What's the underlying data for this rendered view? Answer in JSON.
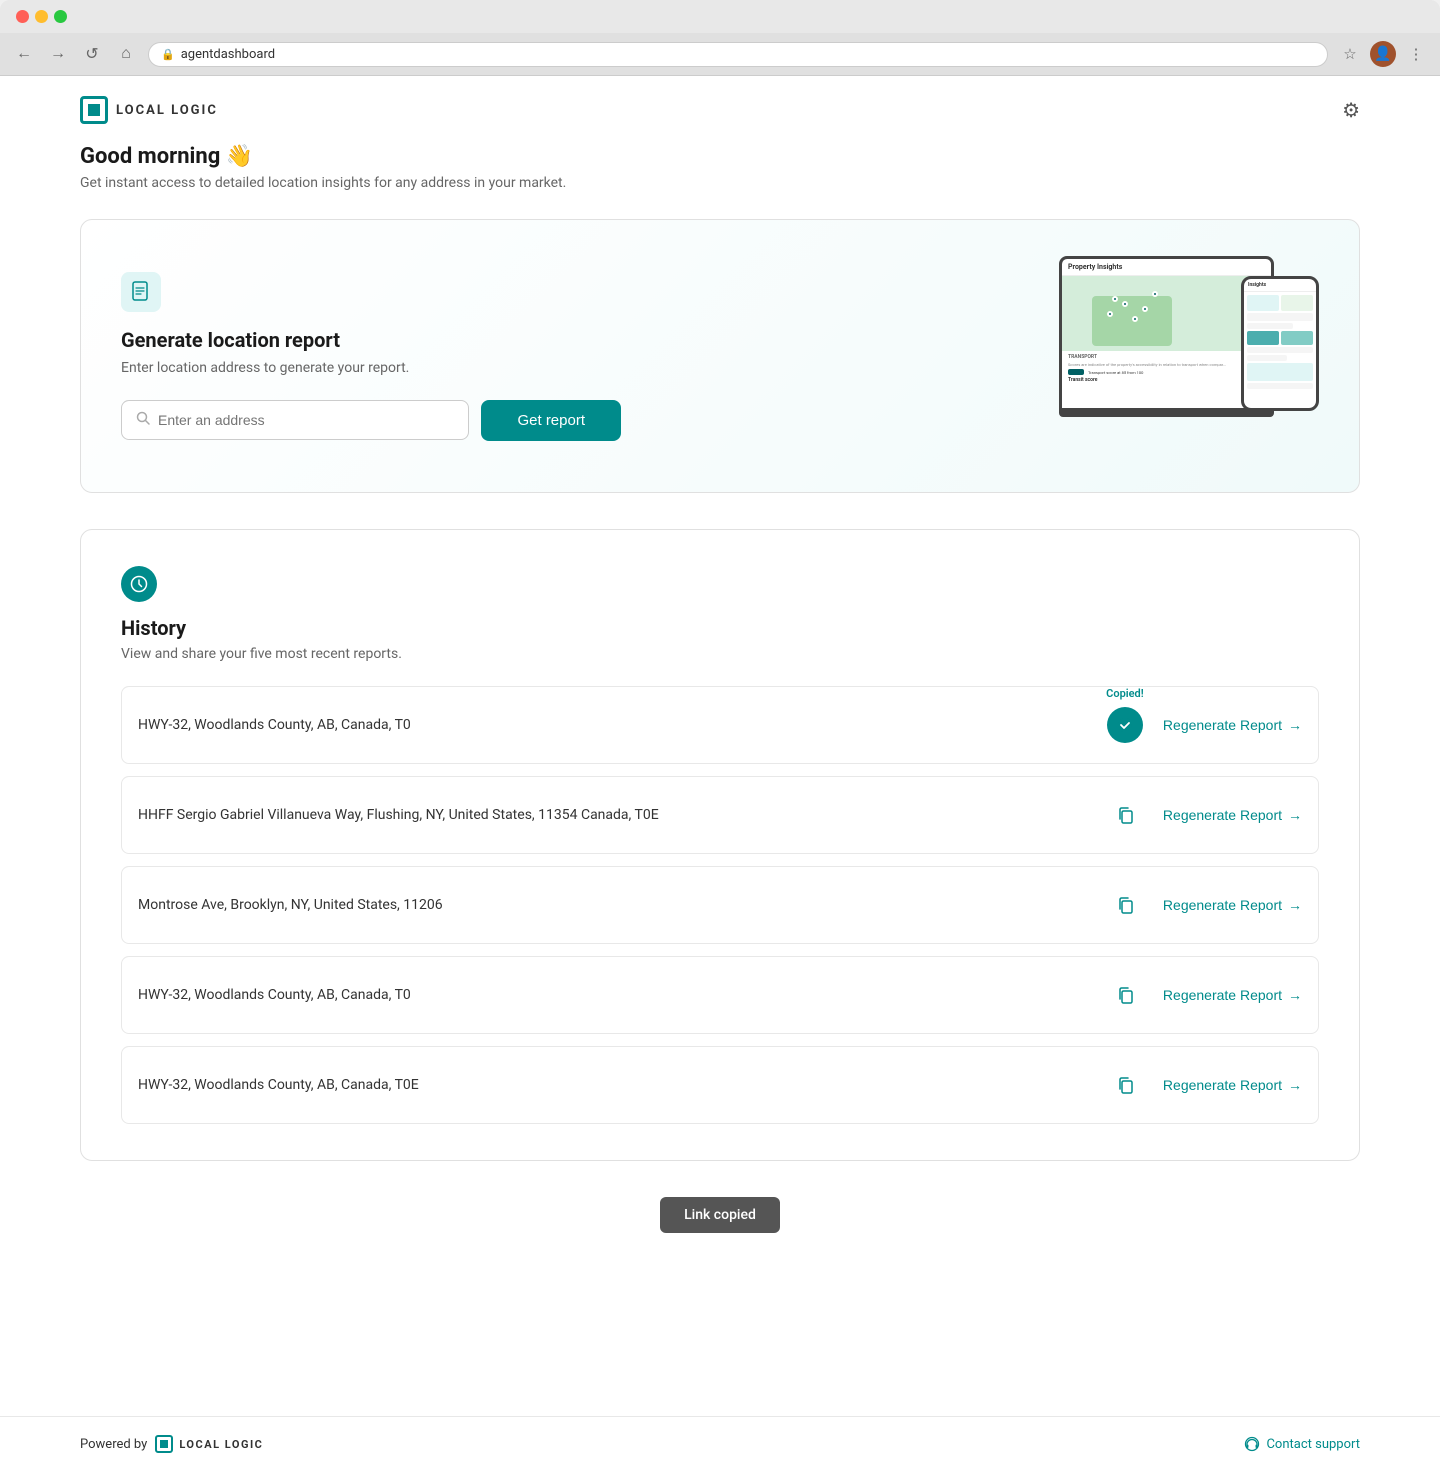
{
  "browser": {
    "url": "agentdashboard",
    "back_label": "←",
    "forward_label": "→",
    "refresh_label": "↺",
    "home_label": "⌂"
  },
  "header": {
    "logo_text": "LOCAL LOGIC",
    "settings_label": "⚙"
  },
  "greeting": {
    "title": "Good morning 👋",
    "subtitle": "Get instant access to detailed location insights for any address in your market."
  },
  "report_card": {
    "title": "Generate location report",
    "description": "Enter location address to generate your report.",
    "input_placeholder": "Enter an address",
    "button_label": "Get report"
  },
  "history": {
    "title": "History",
    "subtitle": "View and share your five most recent reports.",
    "items": [
      {
        "address": "HWY-32, Woodlands County, AB, Canada, T0",
        "copied": true,
        "copied_label": "Copied!",
        "regenerate_label": "Regenerate Report"
      },
      {
        "address": "HHFF Sergio Gabriel Villanueva Way, Flushing, NY, United States, 11354 Canada, T0E",
        "copied": false,
        "copied_label": "",
        "regenerate_label": "Regenerate Report"
      },
      {
        "address": "Montrose Ave, Brooklyn, NY, United States, 11206",
        "copied": false,
        "copied_label": "",
        "regenerate_label": "Regenerate Report"
      },
      {
        "address": "HWY-32, Woodlands County, AB, Canada, T0",
        "copied": false,
        "copied_label": "",
        "regenerate_label": "Regenerate Report"
      },
      {
        "address": "HWY-32, Woodlands County, AB, Canada, T0E",
        "copied": false,
        "copied_label": "",
        "regenerate_label": "Regenerate Report"
      }
    ]
  },
  "toast": {
    "message": "Link copied"
  },
  "footer": {
    "powered_by_label": "Powered by",
    "brand_text": "LOCAL LOGIC",
    "contact_label": "Contact support"
  }
}
